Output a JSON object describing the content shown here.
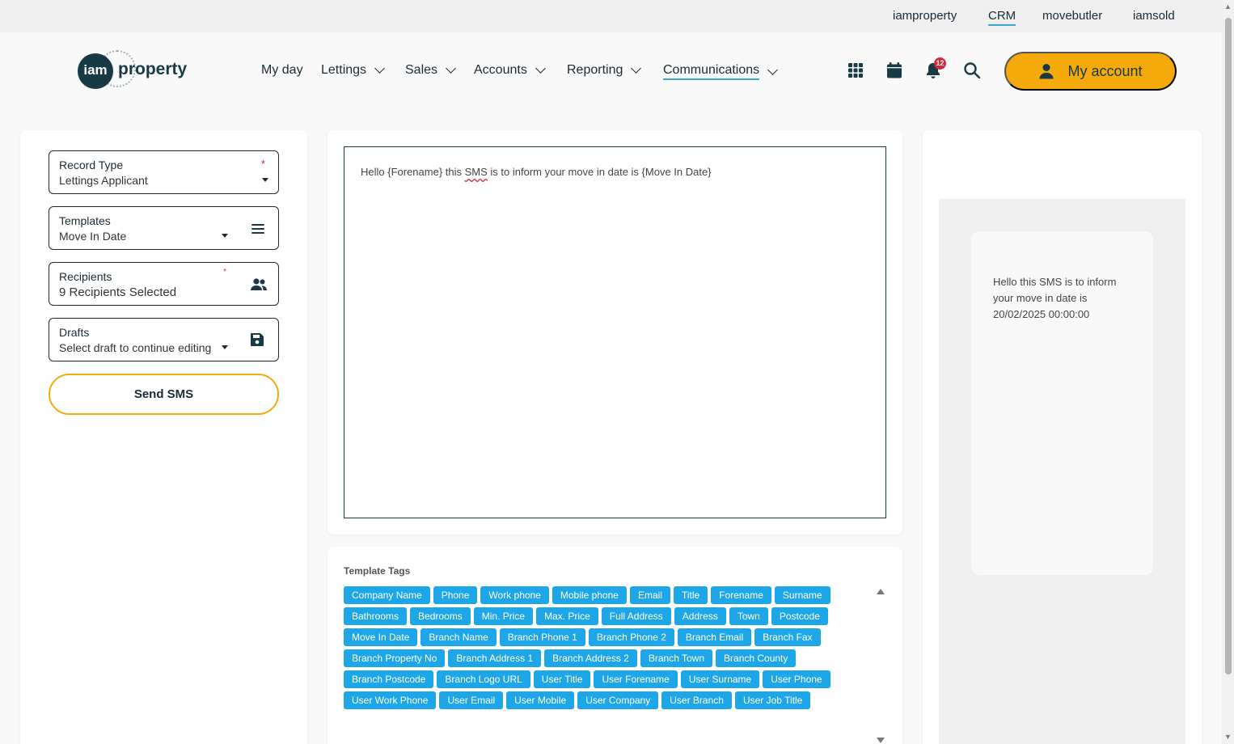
{
  "topbar": {
    "links": [
      {
        "label": "iamproperty"
      },
      {
        "label": "CRM",
        "active": true
      },
      {
        "label": "movebutler"
      },
      {
        "label": "iamsold"
      }
    ]
  },
  "header": {
    "logo_mark": "iam",
    "logo_word": "property",
    "nav": [
      {
        "label": "My day"
      },
      {
        "label": "Lettings"
      },
      {
        "label": "Sales"
      },
      {
        "label": "Accounts"
      },
      {
        "label": "Reporting"
      },
      {
        "label": "Communications",
        "active": true
      }
    ],
    "icons": [
      "apps-grid-icon",
      "calendar-icon",
      "bell-icon",
      "search-icon"
    ],
    "notification_count": "12",
    "my_account_label": "My account"
  },
  "form": {
    "record_type": {
      "label": "Record Type",
      "value": "Lettings Applicant",
      "required_mark": "*"
    },
    "templates": {
      "label": "Templates",
      "value": "Move In Date"
    },
    "recipients": {
      "label": "Recipients",
      "value": "9 Recipients Selected",
      "required_mark": "*"
    },
    "drafts": {
      "label": "Drafts",
      "value": "Select draft to continue editing"
    },
    "send_label": "Send SMS"
  },
  "editor": {
    "before": "Hello {Forename} this ",
    "flagged": "SMS",
    "after": " is to inform your move in date is {Move In Date}"
  },
  "template_tags": {
    "title": "Template Tags",
    "rows": [
      [
        "Company Name",
        "Phone",
        "Work phone",
        "Mobile phone",
        "Email",
        "Title",
        "Forename",
        "Surname"
      ],
      [
        "Bathrooms",
        "Bedrooms",
        "Min. Price",
        "Max. Price",
        "Full Address",
        "Address",
        "Town",
        "Postcode"
      ],
      [
        "Move In Date",
        "Branch Name",
        "Branch Phone 1",
        "Branch Phone 2",
        "Branch Email",
        "Branch Fax"
      ],
      [
        "Branch Property No",
        "Branch Address 1",
        "Branch Address 2",
        "Branch Town",
        "Branch County"
      ],
      [
        "Branch Postcode",
        "Branch Logo URL",
        "User Title",
        "User Forename",
        "User Surname",
        "User Phone"
      ],
      [
        "User Work Phone",
        "User Email",
        "User Mobile",
        "User Company",
        "User Branch",
        "User Job Title"
      ]
    ]
  },
  "preview": {
    "text": "Hello   this SMS is to inform your move in date is 20/02/2025 00:00:00"
  },
  "colors": {
    "accent": "#f5a90a",
    "tag": "#1ea7e8",
    "brand": "#173a44",
    "required": "#d6283b"
  }
}
